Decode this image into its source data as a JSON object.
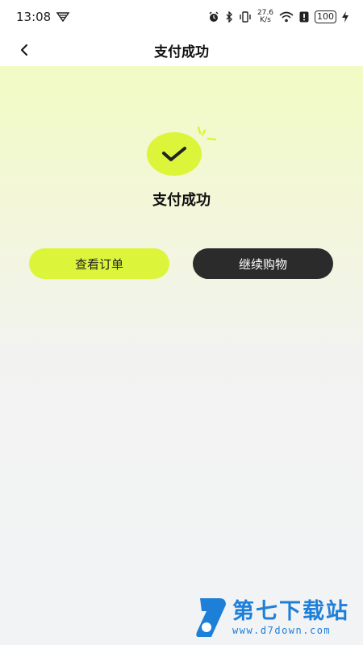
{
  "status_bar": {
    "time": "13:08",
    "net_speed_top": "27.6",
    "net_speed_bottom": "K/s",
    "battery": "100"
  },
  "nav": {
    "title": "支付成功",
    "back_icon": "chevron-left-icon"
  },
  "result": {
    "icon": "check-circle-icon",
    "title": "支付成功"
  },
  "actions": {
    "view_order": "查看订单",
    "continue_shopping": "继续购物"
  },
  "watermark": {
    "name": "第七下载站",
    "url": "www.d7down.com"
  },
  "colors": {
    "accent": "#dcf53a",
    "dark_button": "#2b2b2b",
    "watermark": "#1e7fd8"
  }
}
